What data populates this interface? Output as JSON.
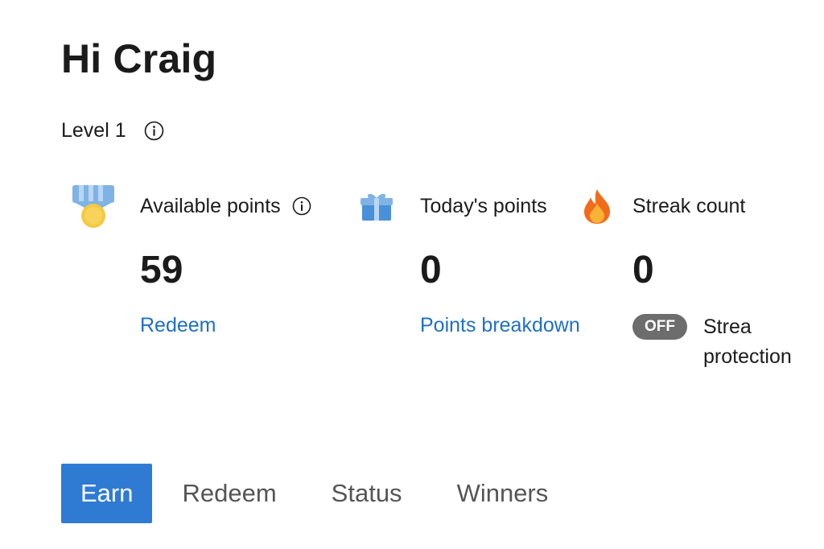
{
  "greeting": "Hi Craig",
  "level": {
    "label": "Level 1",
    "info_icon": "info-icon"
  },
  "stats": {
    "available": {
      "icon": "medal-icon",
      "label": "Available points",
      "value": "59",
      "link": "Redeem"
    },
    "today": {
      "icon": "gift-icon",
      "label": "Today's points",
      "value": "0",
      "link": "Points breakdown"
    },
    "streak": {
      "icon": "flame-icon",
      "label": "Streak count",
      "value": "0",
      "toggle_state": "OFF",
      "protection_line1": "Strea",
      "protection_line2": "protection"
    }
  },
  "tabs": [
    {
      "label": "Earn",
      "active": true
    },
    {
      "label": "Redeem",
      "active": false
    },
    {
      "label": "Status",
      "active": false
    },
    {
      "label": "Winners",
      "active": false
    }
  ],
  "colors": {
    "link": "#1f6fc5",
    "active_tab": "#2f7bd3",
    "toggle_off": "#6d6d6d",
    "medal_ribbon": "#7fb3e6",
    "medal_coin": "#f5c842",
    "gift": "#4a90d9",
    "flame": "#f26b1d"
  }
}
